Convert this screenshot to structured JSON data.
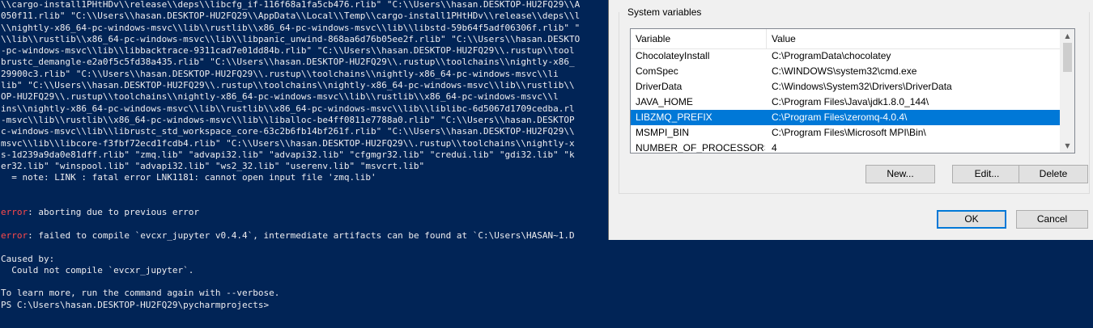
{
  "terminal": {
    "lines": [
      {
        "text": "\\\\cargo-install1PHtHDv\\\\release\\\\deps\\\\libcfg_if-116f68a1fa5cb476.rlib\" \"C:\\\\Users\\\\hasan.DESKTOP-HU2FQ29\\\\A"
      },
      {
        "text": "050f11.rlib\" \"C:\\\\Users\\\\hasan.DESKTOP-HU2FQ29\\\\AppData\\\\Local\\\\Temp\\\\cargo-install1PHtHDv\\\\release\\\\deps\\\\l"
      },
      {
        "text": "\\\\nightly-x86_64-pc-windows-msvc\\\\lib\\\\rustlib\\\\x86_64-pc-windows-msvc\\\\lib\\\\libstd-59b64f5adf06306f.rlib\" \""
      },
      {
        "text": "\\\\lib\\\\rustlib\\\\x86_64-pc-windows-msvc\\\\lib\\\\libpanic_unwind-868aa6d76b05ee2f.rlib\" \"C:\\\\Users\\\\hasan.DESKTO"
      },
      {
        "text": "-pc-windows-msvc\\\\lib\\\\libbacktrace-9311cad7e01dd84b.rlib\" \"C:\\\\Users\\\\hasan.DESKTOP-HU2FQ29\\\\.rustup\\\\tool"
      },
      {
        "text": "brustc_demangle-e2a0f5c5fd38a435.rlib\" \"C:\\\\Users\\\\hasan.DESKTOP-HU2FQ29\\\\.rustup\\\\toolchains\\\\nightly-x86_"
      },
      {
        "text": "29900c3.rlib\" \"C:\\\\Users\\\\hasan.DESKTOP-HU2FQ29\\\\.rustup\\\\toolchains\\\\nightly-x86_64-pc-windows-msvc\\\\li"
      },
      {
        "text": "lib\" \"C:\\\\Users\\\\hasan.DESKTOP-HU2FQ29\\\\.rustup\\\\toolchains\\\\nightly-x86_64-pc-windows-msvc\\\\lib\\\\rustlib\\\\"
      },
      {
        "text": "OP-HU2FQ29\\\\.rustup\\\\toolchains\\\\nightly-x86_64-pc-windows-msvc\\\\lib\\\\rustlib\\\\x86_64-pc-windows-msvc\\\\l"
      },
      {
        "text": "ins\\\\nightly-x86_64-pc-windows-msvc\\\\lib\\\\rustlib\\\\x86_64-pc-windows-msvc\\\\lib\\\\liblibc-6d5067d1709cedba.rl"
      },
      {
        "text": "-msvc\\\\lib\\\\rustlib\\\\x86_64-pc-windows-msvc\\\\lib\\\\liballoc-be4ff0811e7788a0.rlib\" \"C:\\\\Users\\\\hasan.DESKTOP"
      },
      {
        "text": "c-windows-msvc\\\\lib\\\\librustc_std_workspace_core-63c2b6fb14bf261f.rlib\" \"C:\\\\Users\\\\hasan.DESKTOP-HU2FQ29\\\\"
      },
      {
        "text": "msvc\\\\lib\\\\libcore-f3fbf72ecd1fcdb4.rlib\" \"C:\\\\Users\\\\hasan.DESKTOP-HU2FQ29\\\\.rustup\\\\toolchains\\\\nightly-x"
      },
      {
        "text": "s-1d239a9da0e81dff.rlib\" \"zmq.lib\" \"advapi32.lib\" \"advapi32.lib\" \"cfgmgr32.lib\" \"credui.lib\" \"gdi32.lib\" \"k"
      },
      {
        "text": "er32.lib\" \"winspool.lib\" \"advapi32.lib\" \"ws2_32.lib\" \"userenv.lib\" \"msvcrt.lib\""
      },
      {
        "text": "  = note: LINK : fatal error LNK1181: cannot open input file 'zmq.lib'"
      },
      {
        "text": ""
      },
      {
        "text": ""
      },
      {
        "text": ": aborting due to previous error",
        "err": "error"
      },
      {
        "text": ""
      },
      {
        "text": ": failed to compile `evcxr_jupyter v0.4.4`, intermediate artifacts can be found at `C:\\Users\\HASAN~1.D",
        "err": "error"
      },
      {
        "text": ""
      },
      {
        "text": "Caused by:"
      },
      {
        "text": "  Could not compile `evcxr_jupyter`."
      },
      {
        "text": ""
      },
      {
        "text": "To learn more, run the command again with --verbose."
      },
      {
        "text": "PS C:\\Users\\hasan.DESKTOP-HU2FQ29\\pycharmprojects>"
      }
    ]
  },
  "dialog": {
    "group_label": "System variables",
    "columns": {
      "variable": "Variable",
      "value": "Value"
    },
    "rows": [
      {
        "variable": "ChocolateyInstall",
        "value": "C:\\ProgramData\\chocolatey"
      },
      {
        "variable": "ComSpec",
        "value": "C:\\WINDOWS\\system32\\cmd.exe"
      },
      {
        "variable": "DriverData",
        "value": "C:\\Windows\\System32\\Drivers\\DriverData"
      },
      {
        "variable": "JAVA_HOME",
        "value": "C:\\Program Files\\Java\\jdk1.8.0_144\\"
      },
      {
        "variable": "LIBZMQ_PREFIX",
        "value": "C:\\Program Files\\zeromq-4.0.4\\",
        "selected": true
      },
      {
        "variable": "MSMPI_BIN",
        "value": "C:\\Program Files\\Microsoft MPI\\Bin\\"
      },
      {
        "variable": "NUMBER_OF_PROCESSORS",
        "value": "4"
      }
    ],
    "buttons": {
      "new": "New...",
      "edit": "Edit...",
      "delete": "Delete",
      "ok": "OK",
      "cancel": "Cancel"
    },
    "scroll": {
      "up_icon": "▲",
      "down_icon": "▼"
    }
  },
  "colors": {
    "terminal_bg": "#012456",
    "terminal_fg": "#eeedf0",
    "error_red": "#ff4a4a",
    "selection_blue": "#0078d7"
  }
}
